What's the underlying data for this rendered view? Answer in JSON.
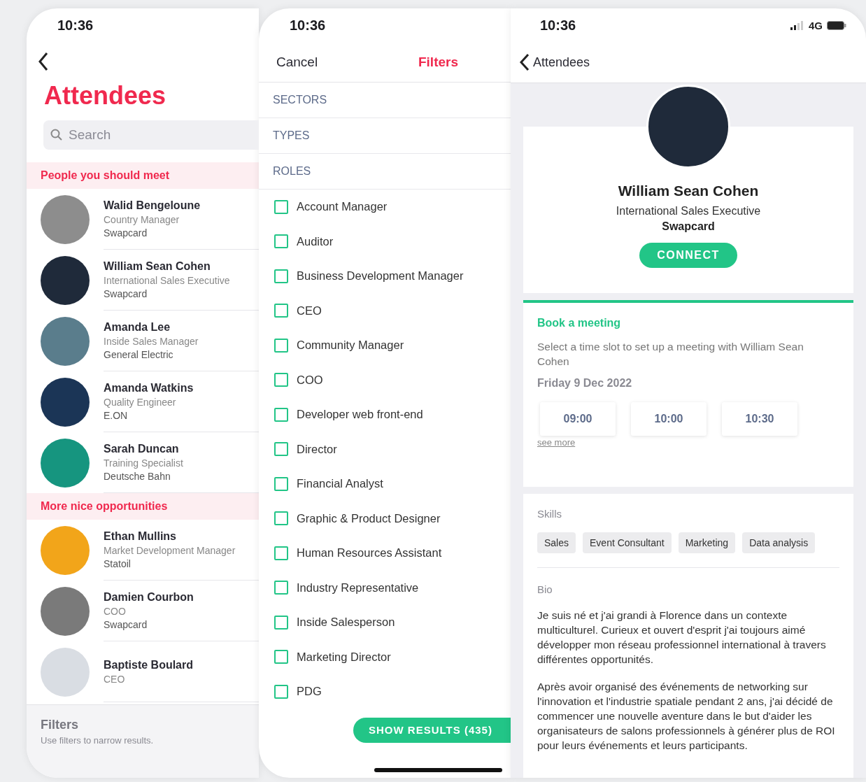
{
  "attendees_screen": {
    "status_time": "10:36",
    "title": "Attendees",
    "search": {
      "placeholder": "Search"
    },
    "sections": [
      {
        "title": "People you should meet",
        "people": [
          {
            "name": "Walid Bengeloune",
            "role": "Country Manager",
            "company": "Swapcard"
          },
          {
            "name": "William Sean Cohen",
            "role": "International Sales Executive",
            "company": "Swapcard"
          },
          {
            "name": "Amanda Lee",
            "role": "Inside Sales Manager",
            "company": "General Electric"
          },
          {
            "name": "Amanda Watkins",
            "role": "Quality Engineer",
            "company": "E.ON"
          },
          {
            "name": "Sarah Duncan",
            "role": "Training Specialist",
            "company": "Deutsche Bahn"
          }
        ]
      },
      {
        "title": "More nice opportunities",
        "people": [
          {
            "name": "Ethan Mullins",
            "role": "Market Development Manager",
            "company": "Statoil"
          },
          {
            "name": "Damien Courbon",
            "role": "COO",
            "company": "Swapcard"
          },
          {
            "name": "Baptiste Boulard",
            "role": "CEO"
          }
        ]
      }
    ],
    "footer": {
      "title": "Filters",
      "hint": "Use filters to narrow results."
    }
  },
  "filters_screen": {
    "status_time": "10:36",
    "cancel": "Cancel",
    "title": "Filters",
    "groups": [
      "SECTORS",
      "TYPES",
      "ROLES"
    ],
    "roles": [
      {
        "label": "Account Manager",
        "checked": false
      },
      {
        "label": "Auditor",
        "checked": false
      },
      {
        "label": "Business Development Manager",
        "checked": false
      },
      {
        "label": "CEO",
        "checked": false
      },
      {
        "label": "Community Manager",
        "checked": false
      },
      {
        "label": "COO",
        "checked": false
      },
      {
        "label": "Developer web front-end",
        "checked": false
      },
      {
        "label": "Director",
        "checked": false
      },
      {
        "label": "Financial Analyst",
        "checked": false
      },
      {
        "label": "Graphic & Product Designer",
        "checked": false
      },
      {
        "label": "Human Resources Assistant",
        "checked": false
      },
      {
        "label": "Industry Representative",
        "checked": false
      },
      {
        "label": "Inside Salesperson",
        "checked": false
      },
      {
        "label": "Marketing Director",
        "checked": false
      },
      {
        "label": "PDG",
        "checked": false
      }
    ],
    "show_results": "SHOW RESULTS (435)"
  },
  "profile_screen": {
    "status_time": "10:36",
    "network": "4G",
    "back": "Attendees",
    "name": "William Sean Cohen",
    "role": "International Sales Executive",
    "company": "Swapcard",
    "connect": "CONNECT",
    "meeting": {
      "title": "Book a meeting",
      "description": "Select a time slot to set up a meeting with William Sean Cohen",
      "date": "Friday 9 Dec 2022",
      "slots": [
        "09:00",
        "10:00",
        "10:30"
      ],
      "see_more": "see more"
    },
    "skills_label": "Skills",
    "skills": [
      "Sales",
      "Event Consultant",
      "Marketing",
      "Data analysis"
    ],
    "bio_label": "Bio",
    "bio": [
      "Je suis né et j'ai grandi à Florence dans un contexte multiculturel. Curieux et ouvert d'esprit j'ai toujours aimé développer mon réseau professionnel international à travers différentes opportunités.",
      "Après avoir organisé des événements de networking sur l'innovation et l'industrie spatiale pendant 2 ans, j'ai décidé de commencer une nouvelle aventure dans le but d'aider les organisateurs de salons professionnels à générer plus de ROI pour leurs événements et leurs participants."
    ]
  }
}
